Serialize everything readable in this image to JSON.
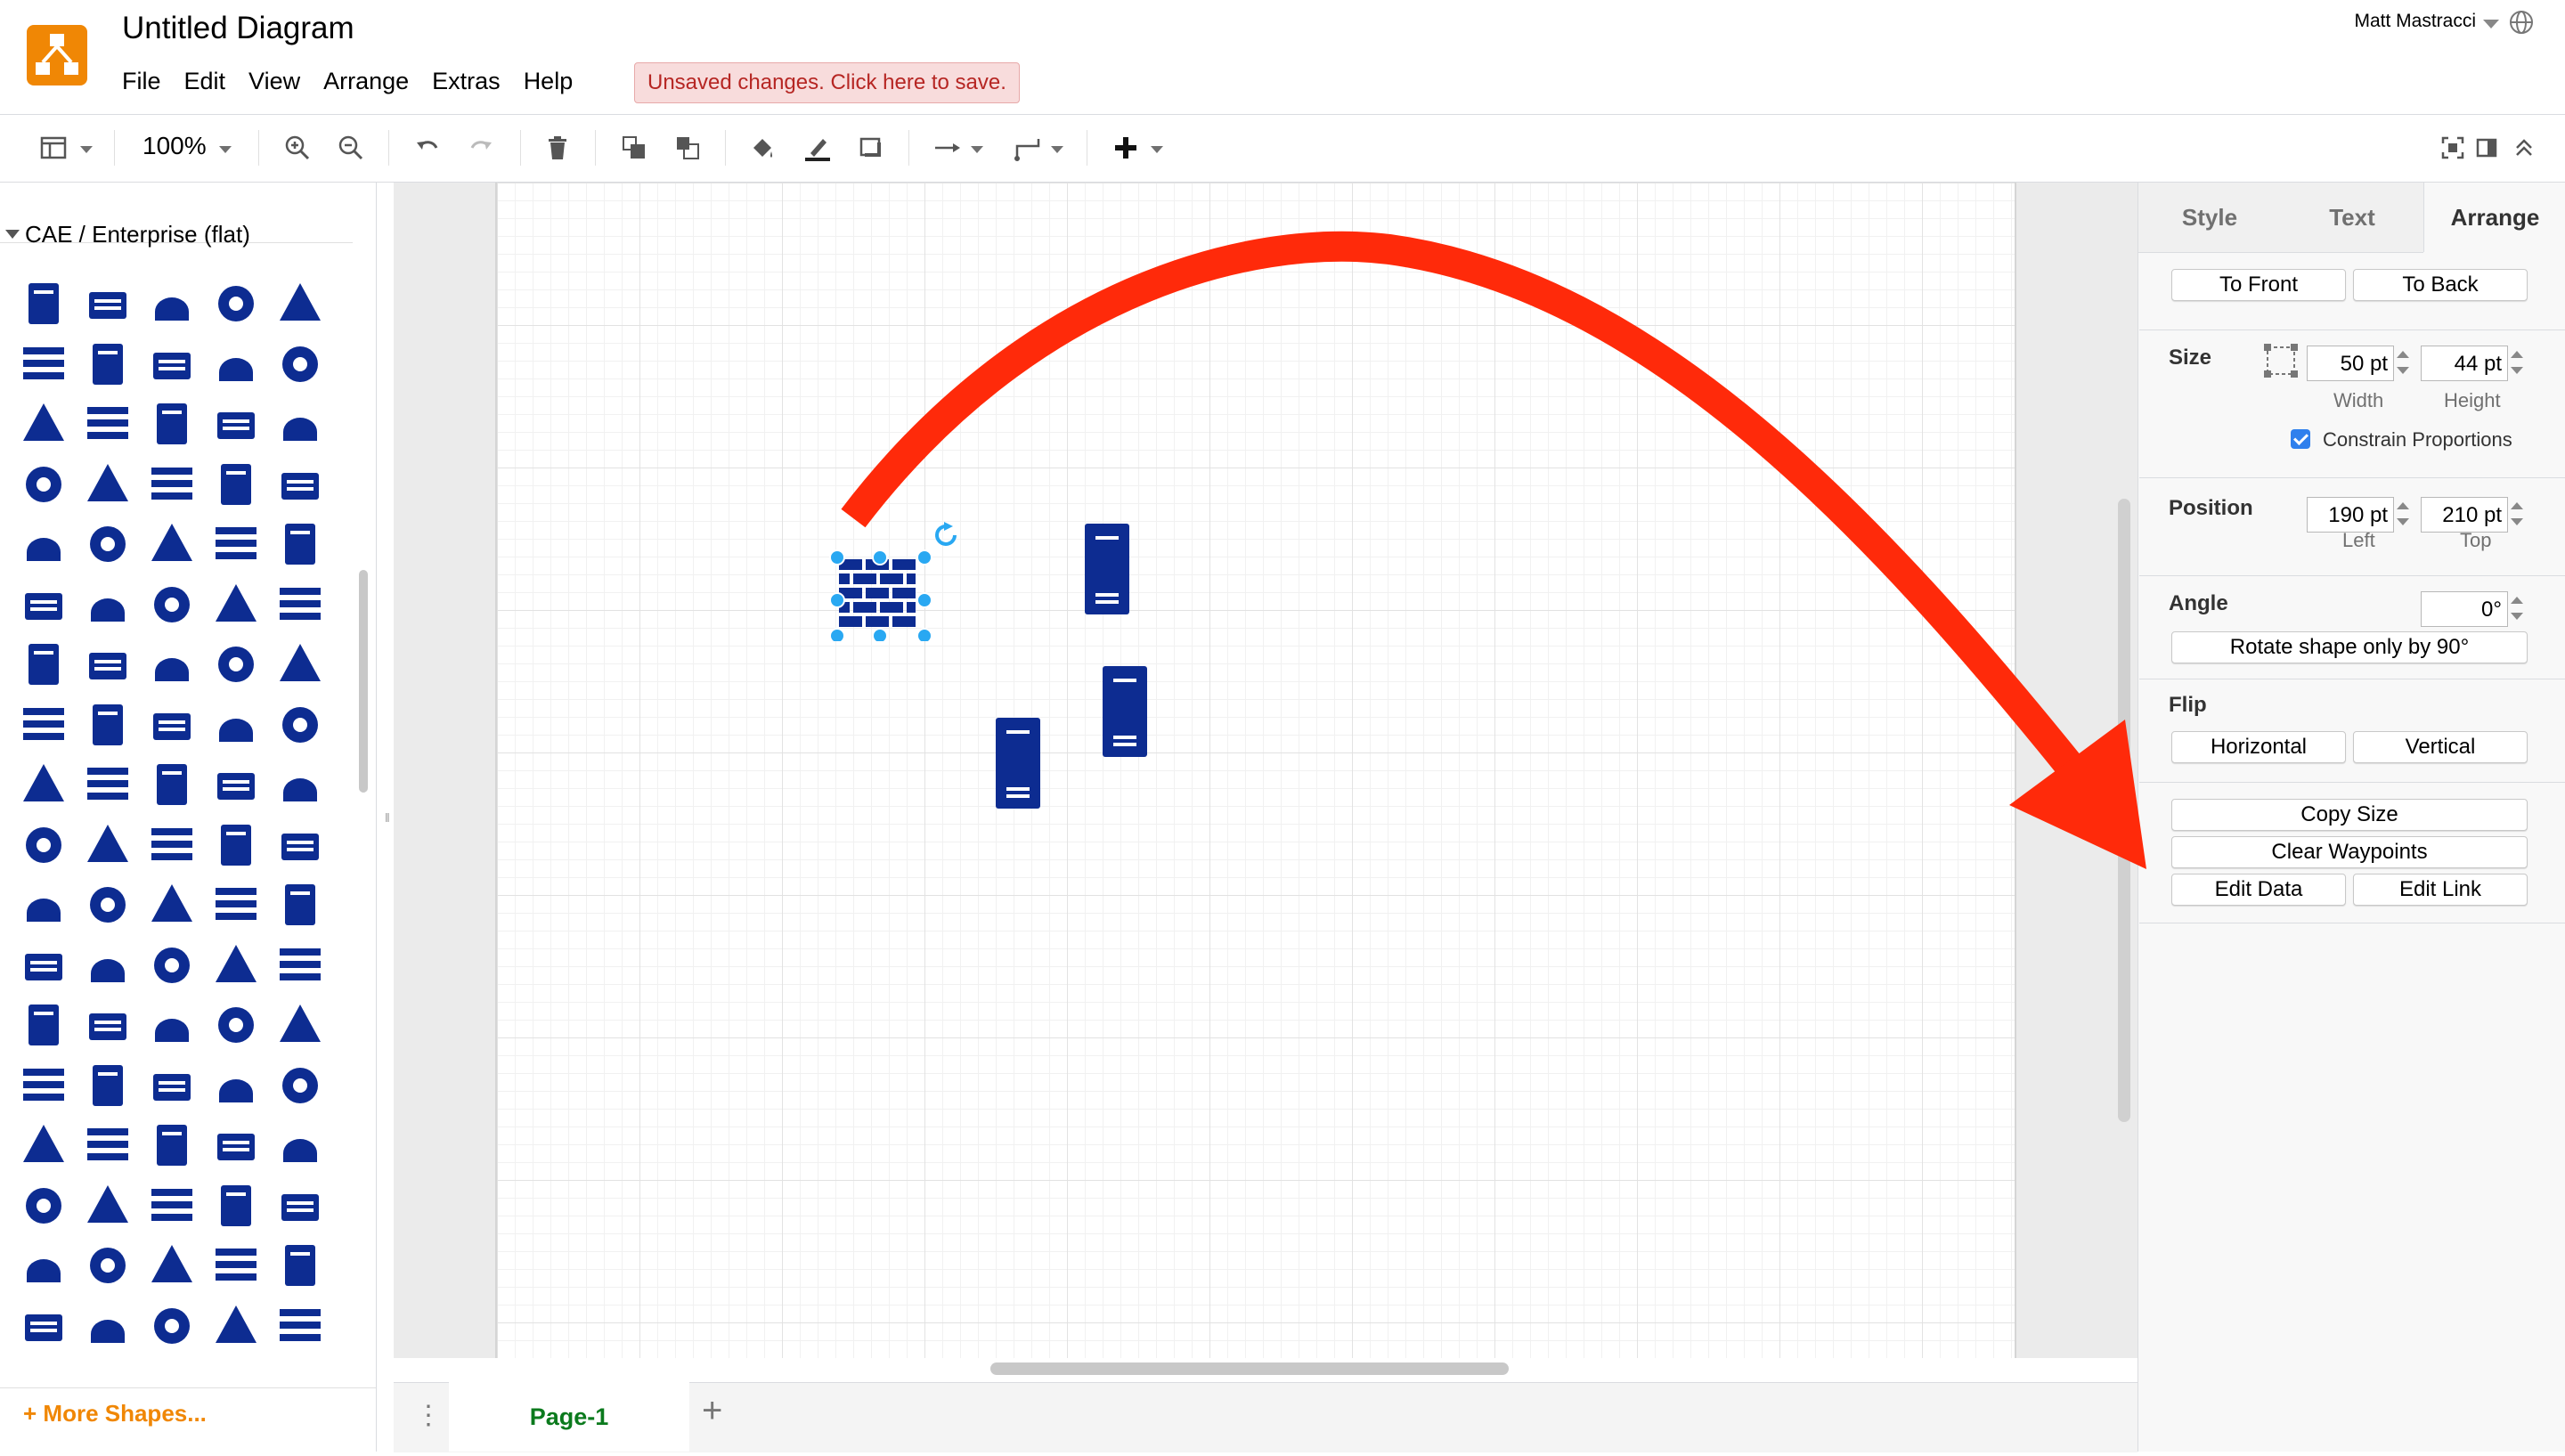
{
  "app": {
    "title": "Untitled Diagram",
    "unsaved_notice": "Unsaved changes. Click here to save.",
    "user": "Matt Mastracci",
    "logo_color": "#f08705"
  },
  "menu": [
    "File",
    "Edit",
    "View",
    "Arrange",
    "Extras",
    "Help"
  ],
  "toolbar": {
    "zoom": "100%",
    "icons": [
      "format-panel-icon",
      "zoom-in-icon",
      "zoom-out-icon",
      "undo-icon",
      "redo-icon",
      "delete-icon",
      "to-front-icon",
      "to-back-icon",
      "fill-color-icon",
      "line-color-icon",
      "shadow-icon",
      "connection-icon",
      "waypoints-icon",
      "insert-icon",
      "fullscreen-icon",
      "toggle-panel-icon",
      "collapse-icon"
    ]
  },
  "sidebar": {
    "library_title": "CAE / Enterprise (flat)",
    "more_shapes": "+ More Shapes...",
    "shape_color": "#0d2c91",
    "shape_icons": [
      "app-server-icon",
      "database-server-icon",
      "android-device-icon",
      "app-icon",
      "browser-window-icon",
      "web-page-icon",
      "server-farm-icon",
      "server-workstation-icon",
      "network-users-icon",
      "download-icon",
      "cloud-upload-icon",
      "calendar-grid-icon",
      "certificate-icon",
      "monitor-screen-icon",
      "cloud-icon",
      "cloud-small-icon",
      "mobile-devices-icon",
      "function-icon",
      "connector-icon",
      "database-icon",
      "file-server-icon",
      "server-sync-icon",
      "switch-icon",
      "workstations-icon",
      "code-braces-icon",
      "document-icon",
      "server-tower-icon",
      "building-icon",
      "list-document-icon",
      "filter-icon",
      "firewall-icon",
      "folder-icon",
      "router-icon",
      "area-chart-icon",
      "heart-monitor-icon",
      "heart-check-icon",
      "document-export-icon",
      "cloud-outline-icon",
      "cloud-filled-icon",
      "key-icon",
      "keyboard-icon",
      "laptop-icon",
      "load-balancer-icon",
      "weightlifter-icon",
      "unlocked-icon",
      "locked-icon",
      "tools-icon",
      "tiles-icon",
      "mail-icon",
      "monitoring-icon",
      "monitor-icon",
      "mouse-icon",
      "network-card-icon",
      "no-entry-icon",
      "waveform-icon",
      "target-icon",
      "mobile-phone-icon",
      "play-icon",
      "powerpoint-icon",
      "powershell-icon",
      "rack-switch-icon",
      "patch-panel-icon",
      "secure-server-icon",
      "network-switch-icon",
      "network-hub-icon",
      "remote-desktop-icon",
      "code-file-icon",
      "service-icon",
      "storage-device-icon",
      "tower-server-icon",
      "server-rack-icon",
      "server-blades-icon",
      "server-stack-icon",
      "settings-gear-icon",
      "shared-folder-icon",
      "site-collection-icon",
      "settings-file-icon",
      "list-view-icon",
      "table-view-icon",
      "tv-screen-icon",
      "toolbox-icon",
      "lightning-file-icon",
      "bar-icon",
      "function-scroll-icon",
      "cross-heart-icon",
      "broken-heart-icon",
      "usb-icon",
      "user-icon",
      "user-support-icon",
      "film-icon"
    ]
  },
  "canvas": {
    "selected_shape": "firewall",
    "shapes": [
      "firewall-shape",
      "server-shape",
      "server-shape",
      "server-shape"
    ],
    "annotation_color": "#ff2a0a",
    "grid_color": "#e2e2e2"
  },
  "pages": {
    "tabs": [
      "Page-1"
    ],
    "active": "Page-1",
    "add": "+"
  },
  "format_panel": {
    "tabs": [
      "Style",
      "Text",
      "Arrange"
    ],
    "active_tab": "Arrange",
    "to_front": "To Front",
    "to_back": "To Back",
    "size_label": "Size",
    "width_value": "50 pt",
    "height_value": "44 pt",
    "width_label": "Width",
    "height_label": "Height",
    "constrain_label": "Constrain Proportions",
    "constrain_checked": true,
    "position_label": "Position",
    "left_value": "190 pt",
    "top_value": "210 pt",
    "left_label": "Left",
    "top_label": "Top",
    "angle_label": "Angle",
    "angle_value": "0°",
    "rotate_button": "Rotate shape only by 90°",
    "flip_label": "Flip",
    "flip_horizontal": "Horizontal",
    "flip_vertical": "Vertical",
    "copy_size": "Copy Size",
    "clear_waypoints": "Clear Waypoints",
    "edit_data": "Edit Data",
    "edit_link": "Edit Link"
  }
}
